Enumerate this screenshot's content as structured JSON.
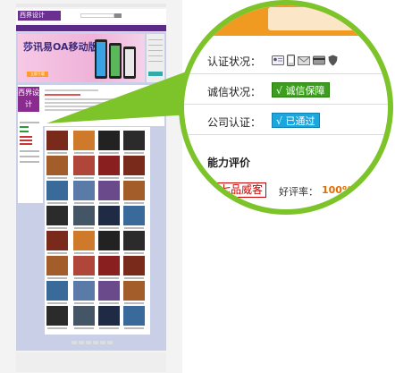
{
  "page": {
    "topbar_text": "",
    "logo_text": "西界设计",
    "logo_sub": "",
    "hotline": "",
    "nav": [
      "",
      "",
      "",
      "",
      "",
      "",
      "",
      ""
    ],
    "banner_title": "莎讯易OA移动版",
    "banner_sub": "",
    "banner_button": "立即下载",
    "profile_logo": "西界设计",
    "footer_links": "",
    "footer_copy": ""
  },
  "magnifier": {
    "rows": [
      {
        "label": "认证状况：",
        "type": "icons",
        "icons": [
          "id-card-icon",
          "mobile-phone-icon",
          "envelope-icon",
          "bank-card-icon",
          "shield-icon"
        ]
      },
      {
        "label": "诚信状况：",
        "badge": "√ 诚信保障",
        "badge_color": "#3b9e1d"
      },
      {
        "label": "公司认证：",
        "badge": "√ 已通过",
        "badge_color": "#19a7df"
      }
    ],
    "ability_title": "能力评价",
    "rank_tag": "七品威客",
    "rating_label": "好评率：",
    "rating_value": "100%"
  },
  "colors": {
    "ring": "#7cc42a",
    "brand_purple": "#5b2a86",
    "accent_orange": "#f09a21",
    "rating_orange": "#e46b00"
  }
}
